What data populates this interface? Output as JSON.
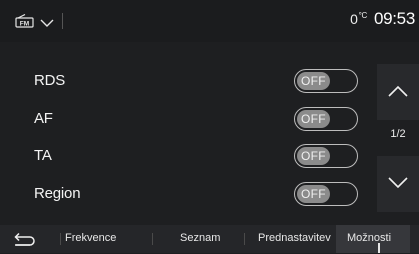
{
  "status": {
    "source_label": "FM",
    "temperature_value": "0",
    "temperature_unit": "°C",
    "time": "09:53"
  },
  "settings": {
    "rows": [
      {
        "label": "RDS",
        "state": "OFF"
      },
      {
        "label": "AF",
        "state": "OFF"
      },
      {
        "label": "TA",
        "state": "OFF"
      },
      {
        "label": "Region",
        "state": "OFF"
      }
    ]
  },
  "pager": {
    "indicator": "1/2"
  },
  "tabs": {
    "items": [
      {
        "label": "Frekvence"
      },
      {
        "label": "Seznam"
      },
      {
        "label": "Prednastavitev"
      },
      {
        "label": "Možnosti"
      }
    ],
    "active_index": 3
  },
  "icons": {
    "source": "radio-fm-icon",
    "source_menu": "chevron-down-icon",
    "scroll_up": "chevron-up-icon",
    "scroll_down": "chevron-down-icon",
    "back": "back-arrow-icon"
  },
  "colors": {
    "background": "#1e1f21",
    "toggle_off_knob": "#8b8b8b",
    "active_tab": "#36373b"
  }
}
